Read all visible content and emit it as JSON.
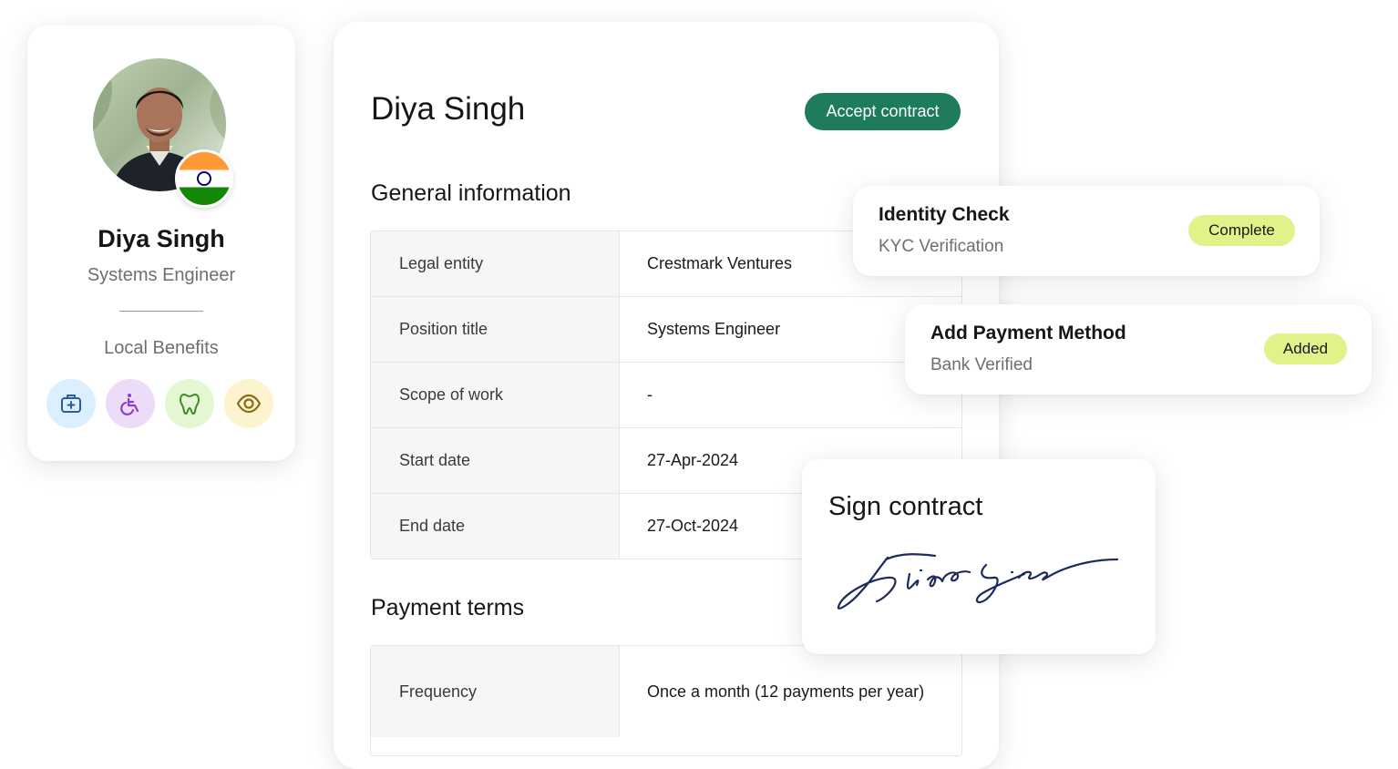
{
  "profile": {
    "name": "Diya Singh",
    "role": "Systems Engineer",
    "benefits_label": "Local Benefits",
    "flag_icon": "india-flag-icon",
    "benefits": [
      {
        "icon": "medical-kit-icon",
        "bg": "#dcefff",
        "color": "#2b5aa8"
      },
      {
        "icon": "wheelchair-icon",
        "bg": "#ecdcf8",
        "color": "#8a3fc9"
      },
      {
        "icon": "tooth-icon",
        "bg": "#e3f7d2",
        "color": "#3f8a2a"
      },
      {
        "icon": "eye-icon",
        "bg": "#fdf4cf",
        "color": "#8a6d12"
      }
    ]
  },
  "contract": {
    "name": "Diya Singh",
    "accept_label": "Accept contract",
    "accent": "#1f7b5d",
    "general_title": "General information",
    "general_rows": [
      {
        "label": "Legal entity",
        "value": "Crestmark Ventures"
      },
      {
        "label": "Position title",
        "value": "Systems Engineer"
      },
      {
        "label": "Scope of work",
        "value": "-"
      },
      {
        "label": "Start date",
        "value": "27-Apr-2024"
      },
      {
        "label": "End date",
        "value": "27-Oct-2024"
      }
    ],
    "payment_title": "Payment terms",
    "payment_rows": [
      {
        "label": "Frequency",
        "value": "Once a month (12 payments per year)"
      }
    ]
  },
  "identity_check": {
    "title": "Identity Check",
    "subtitle": "KYC Verification",
    "badge": "Complete",
    "badge_color": "#dff38a"
  },
  "payment_method": {
    "title": "Add Payment Method",
    "subtitle": "Bank Verified",
    "badge": "Added",
    "badge_color": "#dff38a"
  },
  "sign_contract": {
    "title": "Sign contract",
    "signature": "Diya Singh"
  }
}
